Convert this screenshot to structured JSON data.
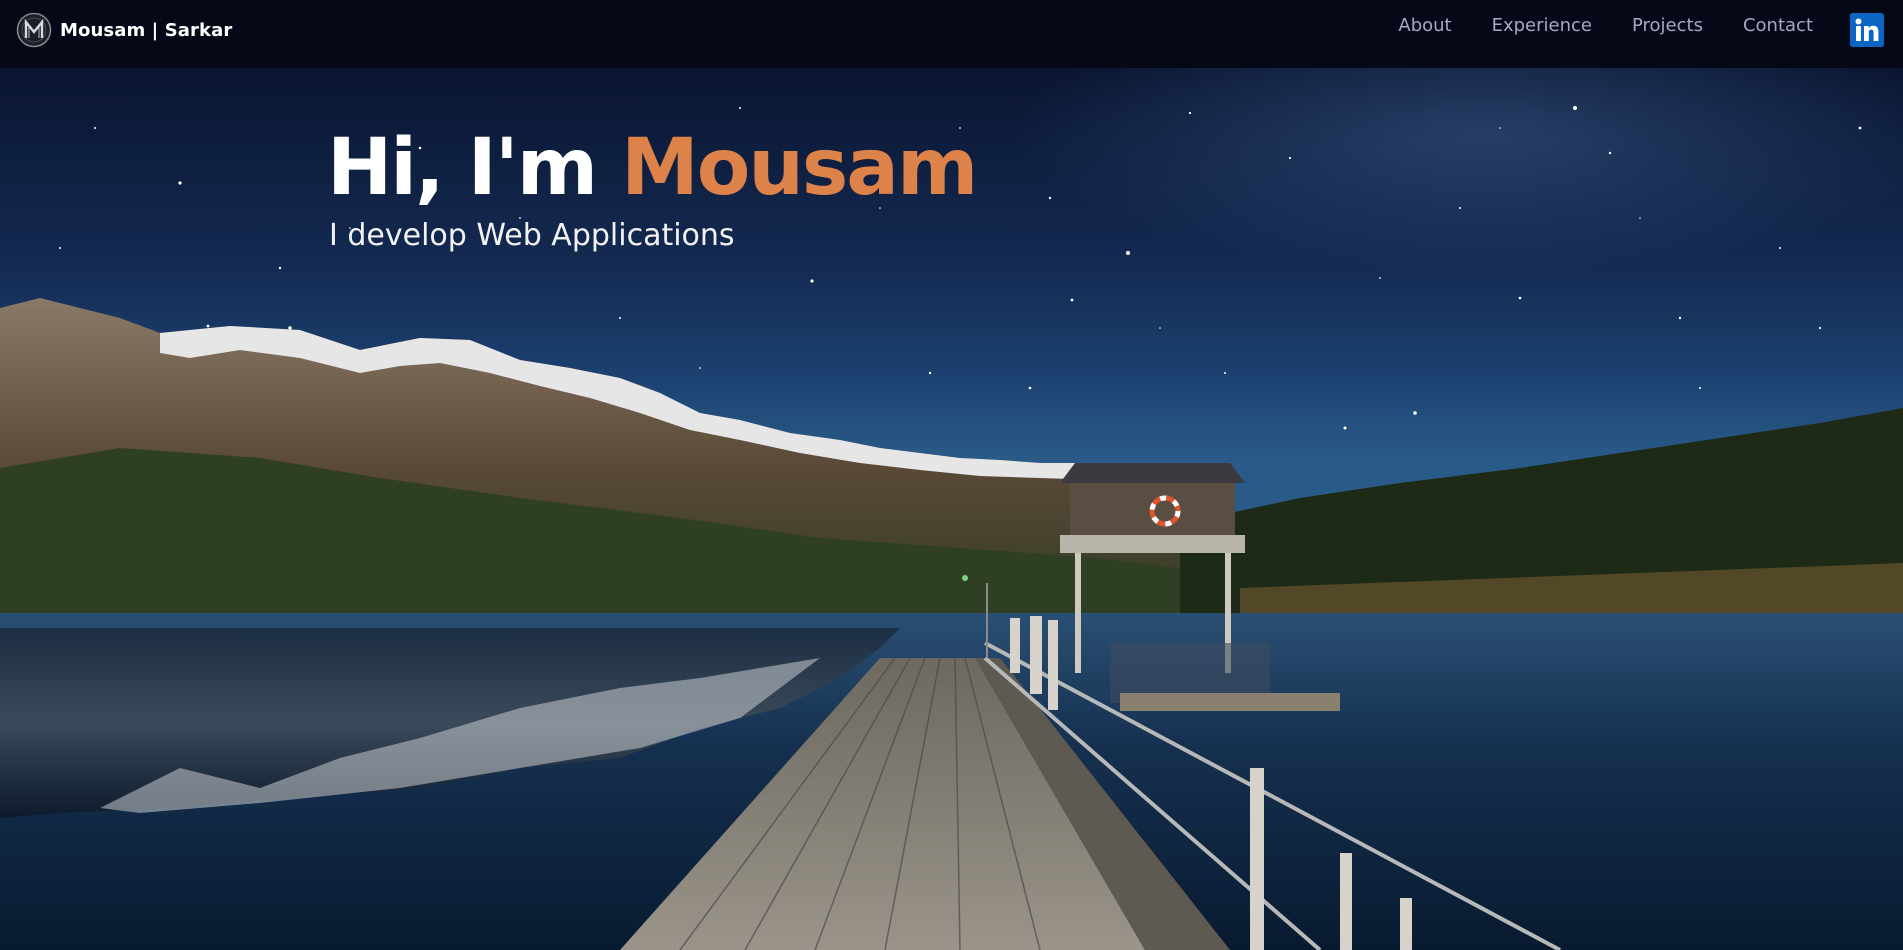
{
  "navbar": {
    "brand": {
      "logo_icon": "m-monogram-logo-icon",
      "name": "Mousam | Sarkar"
    },
    "links": [
      {
        "label": "About"
      },
      {
        "label": "Experience"
      },
      {
        "label": "Projects"
      },
      {
        "label": "Contact"
      }
    ],
    "social_icon": "linkedin-icon"
  },
  "hero": {
    "greeting": "Hi, I'm",
    "name": "Mousam",
    "subtitle": "I develop Web Applications",
    "background": "night-sky-lake-pier-mountains-image"
  },
  "colors": {
    "nav_background": "#050816",
    "nav_link": "#aaa6c3",
    "accent": "#dd8248",
    "linkedin": "#0a66c2"
  }
}
